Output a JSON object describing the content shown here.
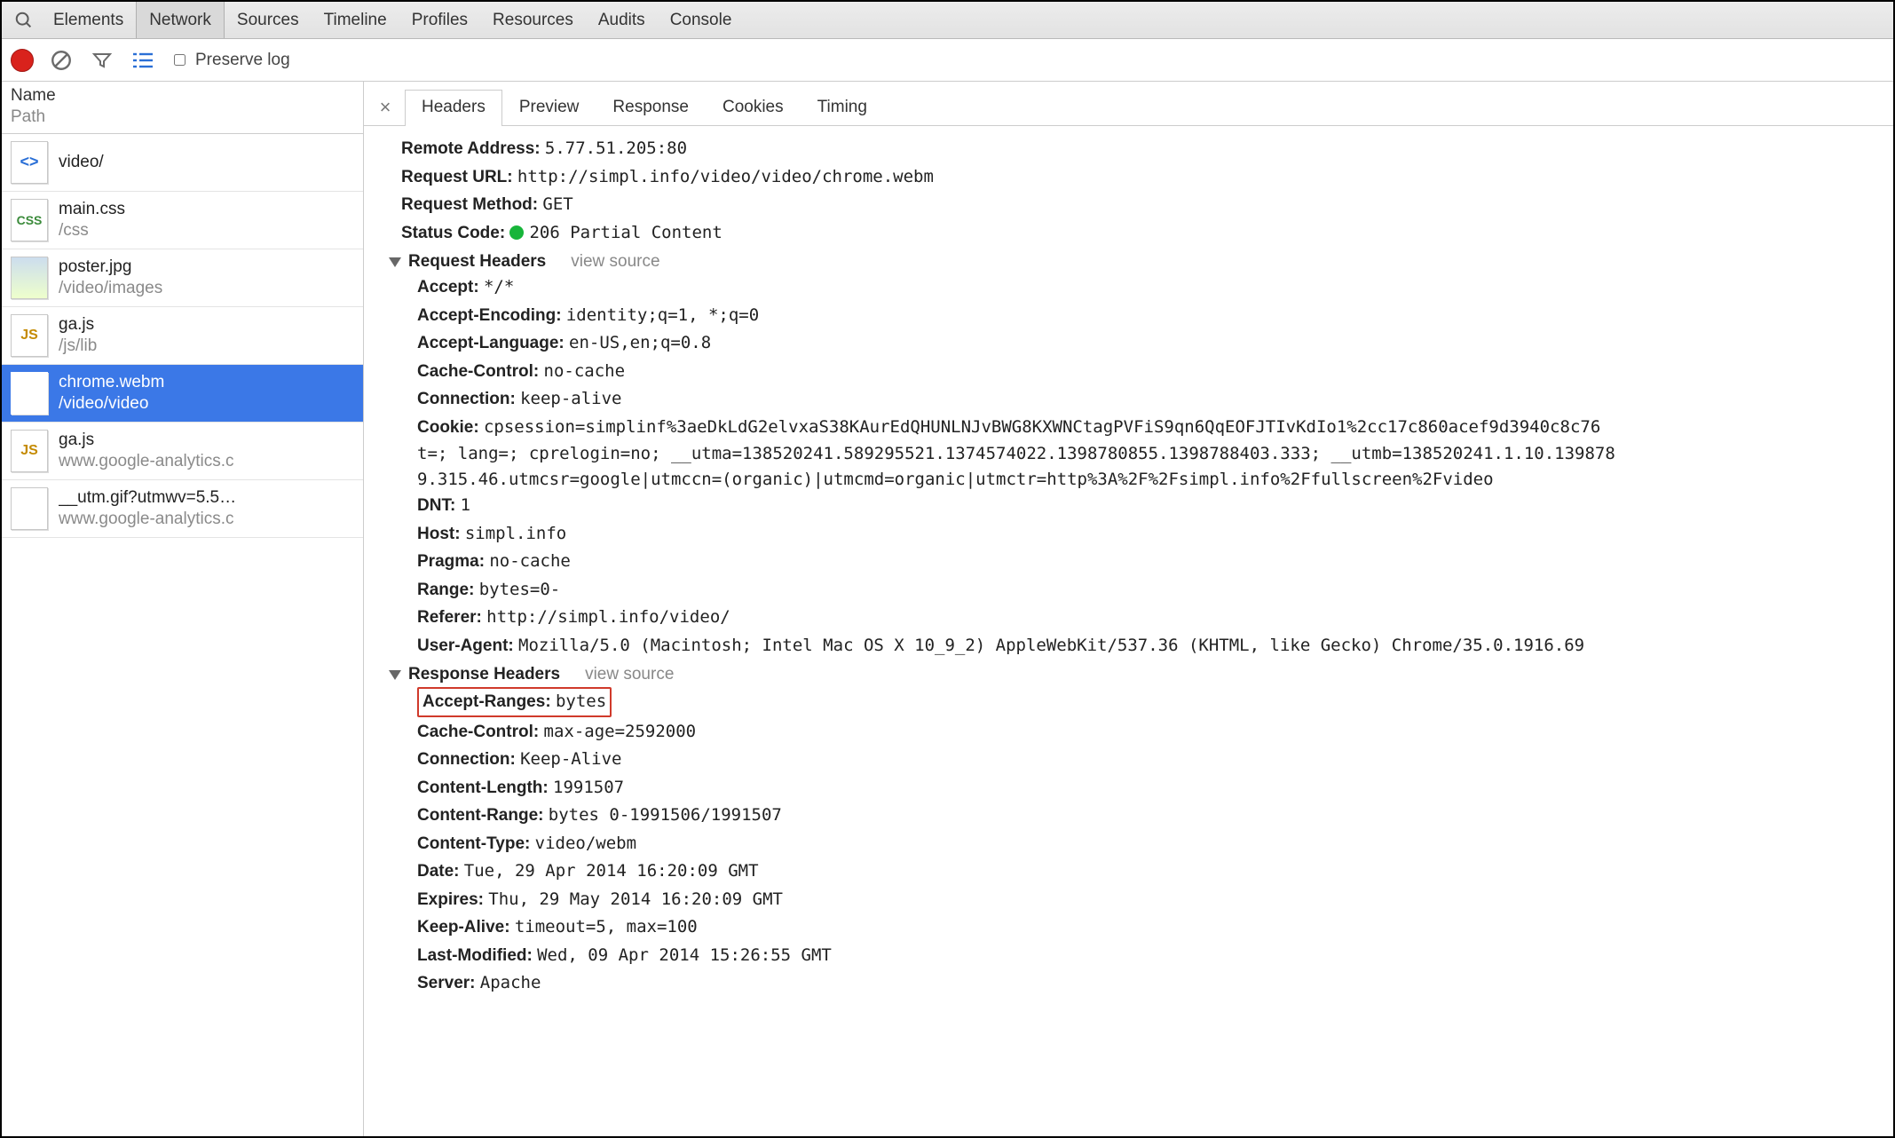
{
  "topTabs": [
    "Elements",
    "Network",
    "Sources",
    "Timeline",
    "Profiles",
    "Resources",
    "Audits",
    "Console"
  ],
  "topActiveIndex": 1,
  "toolbar": {
    "preserve_label": "Preserve log"
  },
  "sidebar": {
    "head1": "Name",
    "head2": "Path",
    "rows": [
      {
        "name": "video/",
        "path": "",
        "kind": "html",
        "selected": false
      },
      {
        "name": "main.css",
        "path": "/css",
        "kind": "css",
        "selected": false
      },
      {
        "name": "poster.jpg",
        "path": "/video/images",
        "kind": "img",
        "selected": false
      },
      {
        "name": "ga.js",
        "path": "/js/lib",
        "kind": "js",
        "selected": false
      },
      {
        "name": "chrome.webm",
        "path": "/video/video",
        "kind": "vid",
        "selected": true
      },
      {
        "name": "ga.js",
        "path": "www.google-analytics.c",
        "kind": "js",
        "selected": false
      },
      {
        "name": "__utm.gif?utmwv=5.5…",
        "path": "www.google-analytics.c",
        "kind": "gif",
        "selected": false
      }
    ]
  },
  "detailTabs": [
    "Headers",
    "Preview",
    "Response",
    "Cookies",
    "Timing"
  ],
  "detailActiveIndex": 0,
  "summary": {
    "remote_label": "Remote Address:",
    "remote": "5.77.51.205:80",
    "url_label": "Request URL:",
    "url": "http://simpl.info/video/video/chrome.webm",
    "method_label": "Request Method:",
    "method": "GET",
    "status_label": "Status Code:",
    "status": "206 Partial Content"
  },
  "sections": {
    "req_title": "Request Headers",
    "res_title": "Response Headers",
    "view_source": "view source"
  },
  "req": {
    "accept_k": "Accept:",
    "accept_v": "*/*",
    "aenc_k": "Accept-Encoding:",
    "aenc_v": "identity;q=1, *;q=0",
    "alang_k": "Accept-Language:",
    "alang_v": "en-US,en;q=0.8",
    "cctrl_k": "Cache-Control:",
    "cctrl_v": "no-cache",
    "conn_k": "Connection:",
    "conn_v": "keep-alive",
    "cookie_k": "Cookie:",
    "cookie_l1": "cpsession=simplinf%3aeDkLdG2elvxaS38KAurEdQHUNLNJvBWG8KXWNCtagPVFiS9qn6QqEOFJTIvKdIo1%2cc17c860acef9d3940c8c76",
    "cookie_l2": "t=; lang=; cprelogin=no; __utma=138520241.589295521.1374574022.1398780855.1398788403.333; __utmb=138520241.1.10.139878",
    "cookie_l3": "9.315.46.utmcsr=google|utmccn=(organic)|utmcmd=organic|utmctr=http%3A%2F%2Fsimpl.info%2Ffullscreen%2Fvideo",
    "dnt_k": "DNT:",
    "dnt_v": "1",
    "host_k": "Host:",
    "host_v": "simpl.info",
    "pragma_k": "Pragma:",
    "pragma_v": "no-cache",
    "range_k": "Range:",
    "range_v": "bytes=0-",
    "ref_k": "Referer:",
    "ref_v": "http://simpl.info/video/",
    "ua_k": "User-Agent:",
    "ua_v": "Mozilla/5.0 (Macintosh; Intel Mac OS X 10_9_2) AppleWebKit/537.36 (KHTML, like Gecko) Chrome/35.0.1916.69"
  },
  "res": {
    "arange_k": "Accept-Ranges:",
    "arange_v": "bytes",
    "cctrl_k": "Cache-Control:",
    "cctrl_v": "max-age=2592000",
    "conn_k": "Connection:",
    "conn_v": "Keep-Alive",
    "clen_k": "Content-Length:",
    "clen_v": "1991507",
    "crange_k": "Content-Range:",
    "crange_v": "bytes 0-1991506/1991507",
    "ctype_k": "Content-Type:",
    "ctype_v": "video/webm",
    "date_k": "Date:",
    "date_v": "Tue, 29 Apr 2014 16:20:09 GMT",
    "exp_k": "Expires:",
    "exp_v": "Thu, 29 May 2014 16:20:09 GMT",
    "ka_k": "Keep-Alive:",
    "ka_v": "timeout=5, max=100",
    "lm_k": "Last-Modified:",
    "lm_v": "Wed, 09 Apr 2014 15:26:55 GMT",
    "srv_k": "Server:",
    "srv_v": "Apache"
  }
}
